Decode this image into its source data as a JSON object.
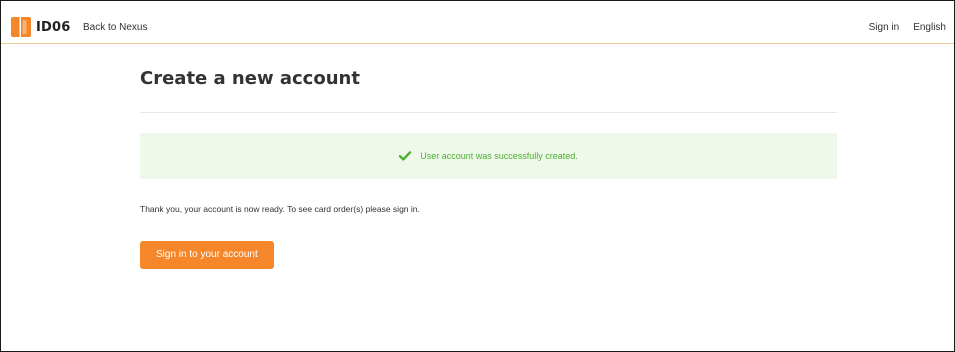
{
  "header": {
    "logo_text": "ID06",
    "back_link": "Back to Nexus",
    "sign_in": "Sign in",
    "language": "English"
  },
  "main": {
    "title": "Create a new account",
    "alert_message": "User account was successfully created.",
    "body_text": "Thank you, your account is now ready. To see card order(s) please sign in.",
    "button_label": "Sign in to your account"
  },
  "colors": {
    "brand_orange": "#f5862a",
    "success_green": "#4caf32",
    "success_bg": "#eef9ea"
  }
}
